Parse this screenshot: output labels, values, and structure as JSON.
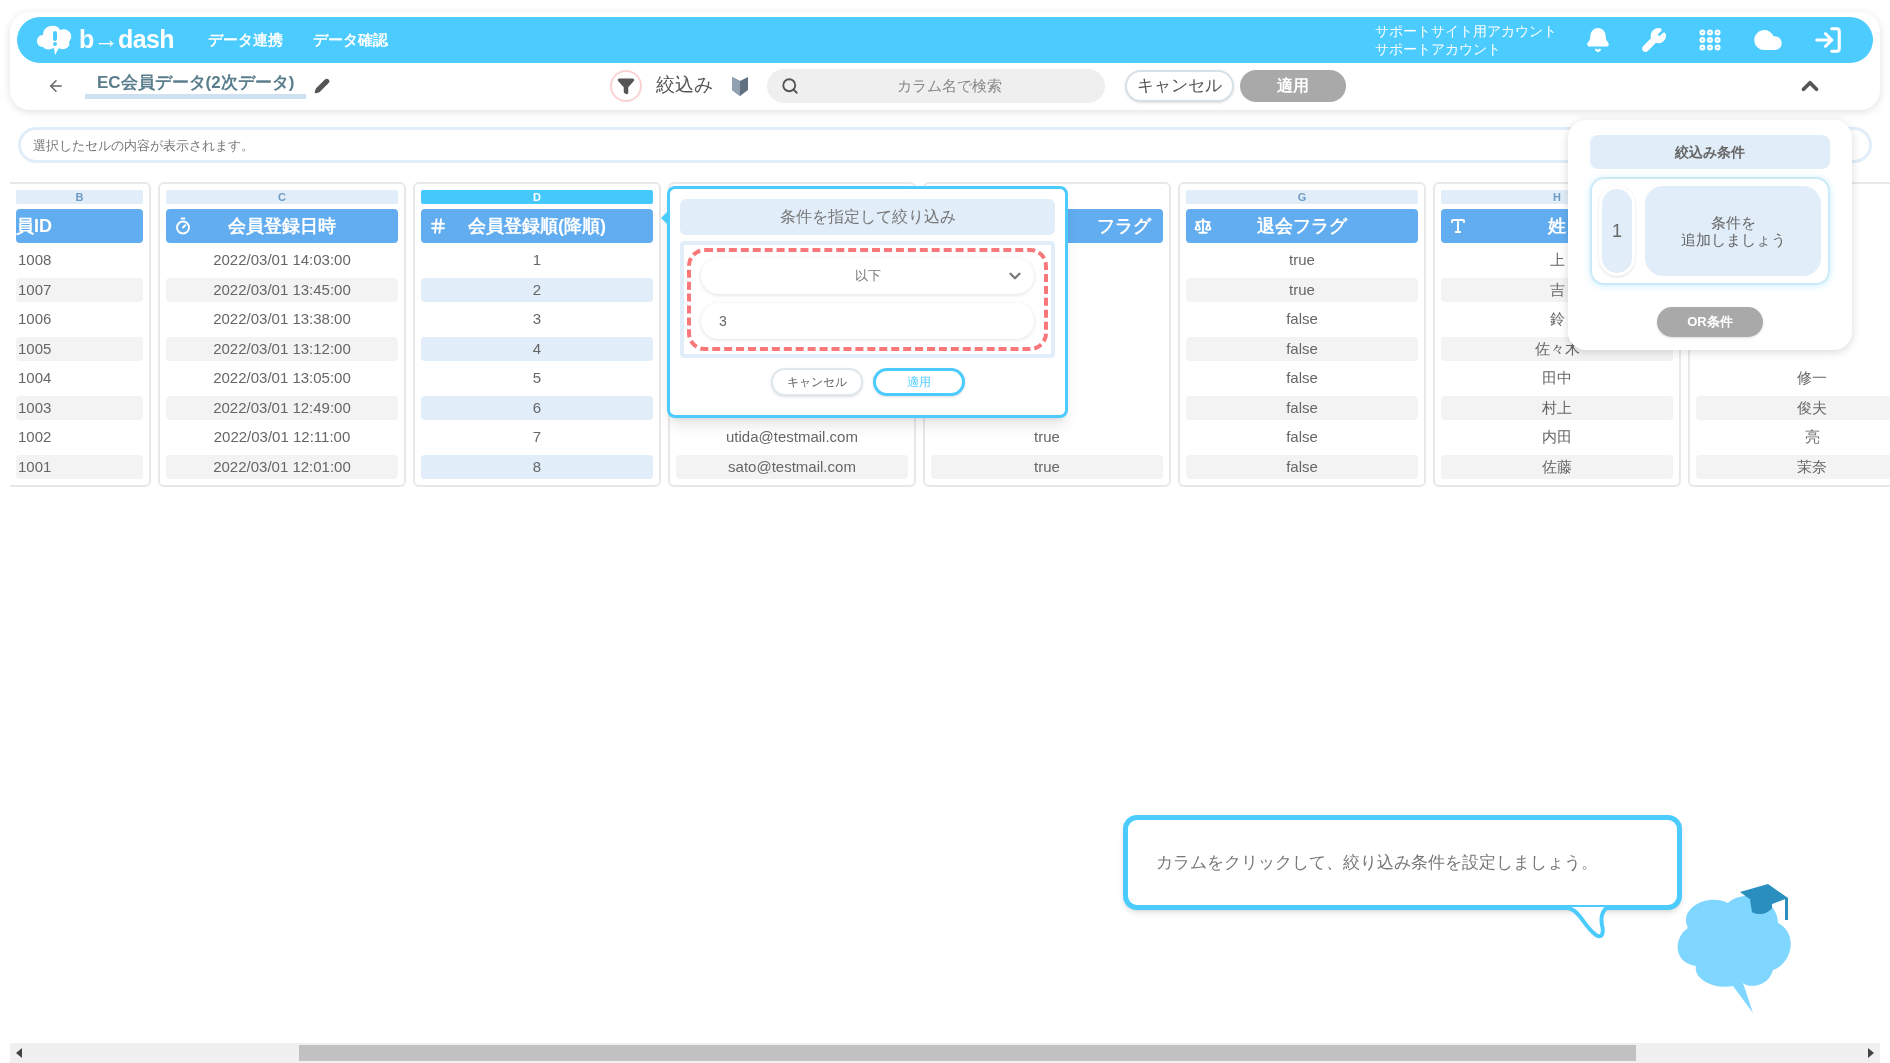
{
  "header": {
    "logo": "b→dash",
    "nav": [
      {
        "label": "データ連携"
      },
      {
        "label": "データ確認"
      }
    ],
    "account": [
      "サポートサイト用アカウント",
      "サポートアカウント"
    ]
  },
  "toolbar": {
    "title": "EC会員データ(2次データ)",
    "filter_label": "絞込み",
    "search": {
      "placeholder": "カラム名で検索"
    },
    "cancel": "キャンセル",
    "apply": {
      "label": "適用",
      "disabled": true
    }
  },
  "cell_content": {
    "placeholder": "選択したセルの内容が表示されます。"
  },
  "columns": [
    {
      "letter": "B",
      "header": "員ID",
      "kind": "id",
      "selected": false,
      "cells": [
        "1008",
        "1007",
        "1006",
        "1005",
        "1004",
        "1003",
        "1002",
        "1001"
      ]
    },
    {
      "letter": "C",
      "header": "会員登録日時",
      "kind": "time",
      "selected": false,
      "cells": [
        "2022/03/01 14:03:00",
        "2022/03/01 13:45:00",
        "2022/03/01 13:38:00",
        "2022/03/01 13:12:00",
        "2022/03/01 13:05:00",
        "2022/03/01 12:49:00",
        "2022/03/01 12:11:00",
        "2022/03/01 12:01:00"
      ]
    },
    {
      "letter": "D",
      "header": "会員登録順(降順)",
      "kind": "number",
      "selected": true,
      "cells": [
        "1",
        "2",
        "3",
        "4",
        "5",
        "6",
        "7",
        "8"
      ]
    },
    {
      "kind": "email",
      "selected": false,
      "cells": [
        "utida@testmail.com",
        "sato@testmail.com"
      ]
    },
    {
      "header": "フラグ",
      "kind": "flag",
      "selected": false,
      "cells": [
        "true",
        "true"
      ]
    },
    {
      "letter": "G",
      "header": "退会フラグ",
      "kind": "bool",
      "selected": false,
      "cells": [
        "true",
        "true",
        "false",
        "false",
        "false",
        "false",
        "false",
        "false"
      ]
    },
    {
      "letter": "H",
      "header": "姓",
      "kind": "text",
      "selected": false,
      "cells": [
        "上",
        "吉",
        "鈴",
        "佐々木",
        "田中",
        "村上",
        "内田",
        "佐藤"
      ]
    },
    {
      "kind": "name",
      "selected": false,
      "cells": [
        "修一",
        "俊夫",
        "亮",
        "茉奈"
      ]
    }
  ],
  "filter_popover": {
    "title": "条件を指定して絞り込み",
    "operator": "以下",
    "value": "3",
    "highlight": true,
    "cancel": "キャンセル",
    "apply": "適用"
  },
  "conditions_panel": {
    "title": "絞込み条件",
    "conditions": [
      {
        "number": "1",
        "text_lines": [
          "条件を",
          "追加しましょう"
        ]
      }
    ],
    "or_button": {
      "label": "OR条件",
      "disabled": true
    }
  },
  "callout": {
    "text": "カラムをクリックして、絞り込み条件を設定しましょう。"
  }
}
